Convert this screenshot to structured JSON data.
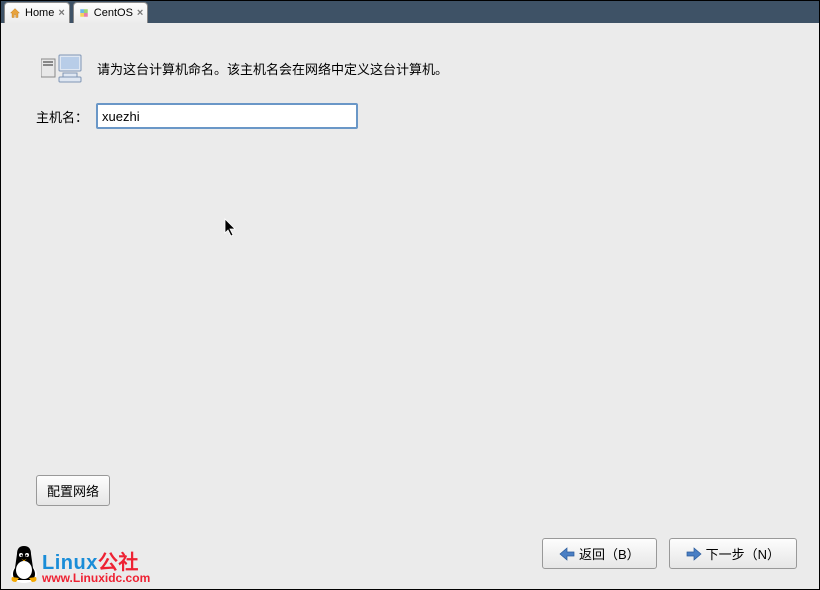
{
  "tabs": [
    {
      "label": "Home"
    },
    {
      "label": "CentOS"
    }
  ],
  "tooltip": {
    "home": "Home"
  },
  "installer": {
    "description": "请为这台计算机命名。该主机名会在网络中定义这台计算机。",
    "hostname_label": "主机名：",
    "hostname_value": "xuezhi",
    "config_network_btn": "配置网络",
    "back_btn": "返回（B）",
    "next_btn": "下一步（N）"
  },
  "watermark": {
    "title_part1": "Linux",
    "title_part2": "公社",
    "url": "www.Linuxidc.com"
  }
}
